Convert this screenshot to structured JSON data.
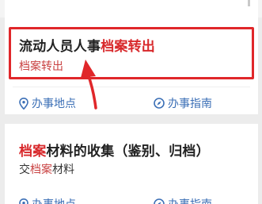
{
  "card1": {
    "title_prefix": "流动人员人事",
    "title_keyword": "档案转出",
    "subtitle_keyword": "档案转出",
    "location_action": "办事地点",
    "guide_action": "办事指南"
  },
  "card2": {
    "title_keyword": "档案",
    "title_suffix": "材料的收集（鉴别、归档）",
    "subtitle_prefix": "交",
    "subtitle_keyword": "档案",
    "subtitle_suffix": "材料",
    "location_action": "办事地点",
    "guide_action": "办事指南"
  },
  "colors": {
    "keyword_highlight": "#d8282b",
    "annotation": "#e0272a",
    "action_link": "#3b6fb6"
  }
}
